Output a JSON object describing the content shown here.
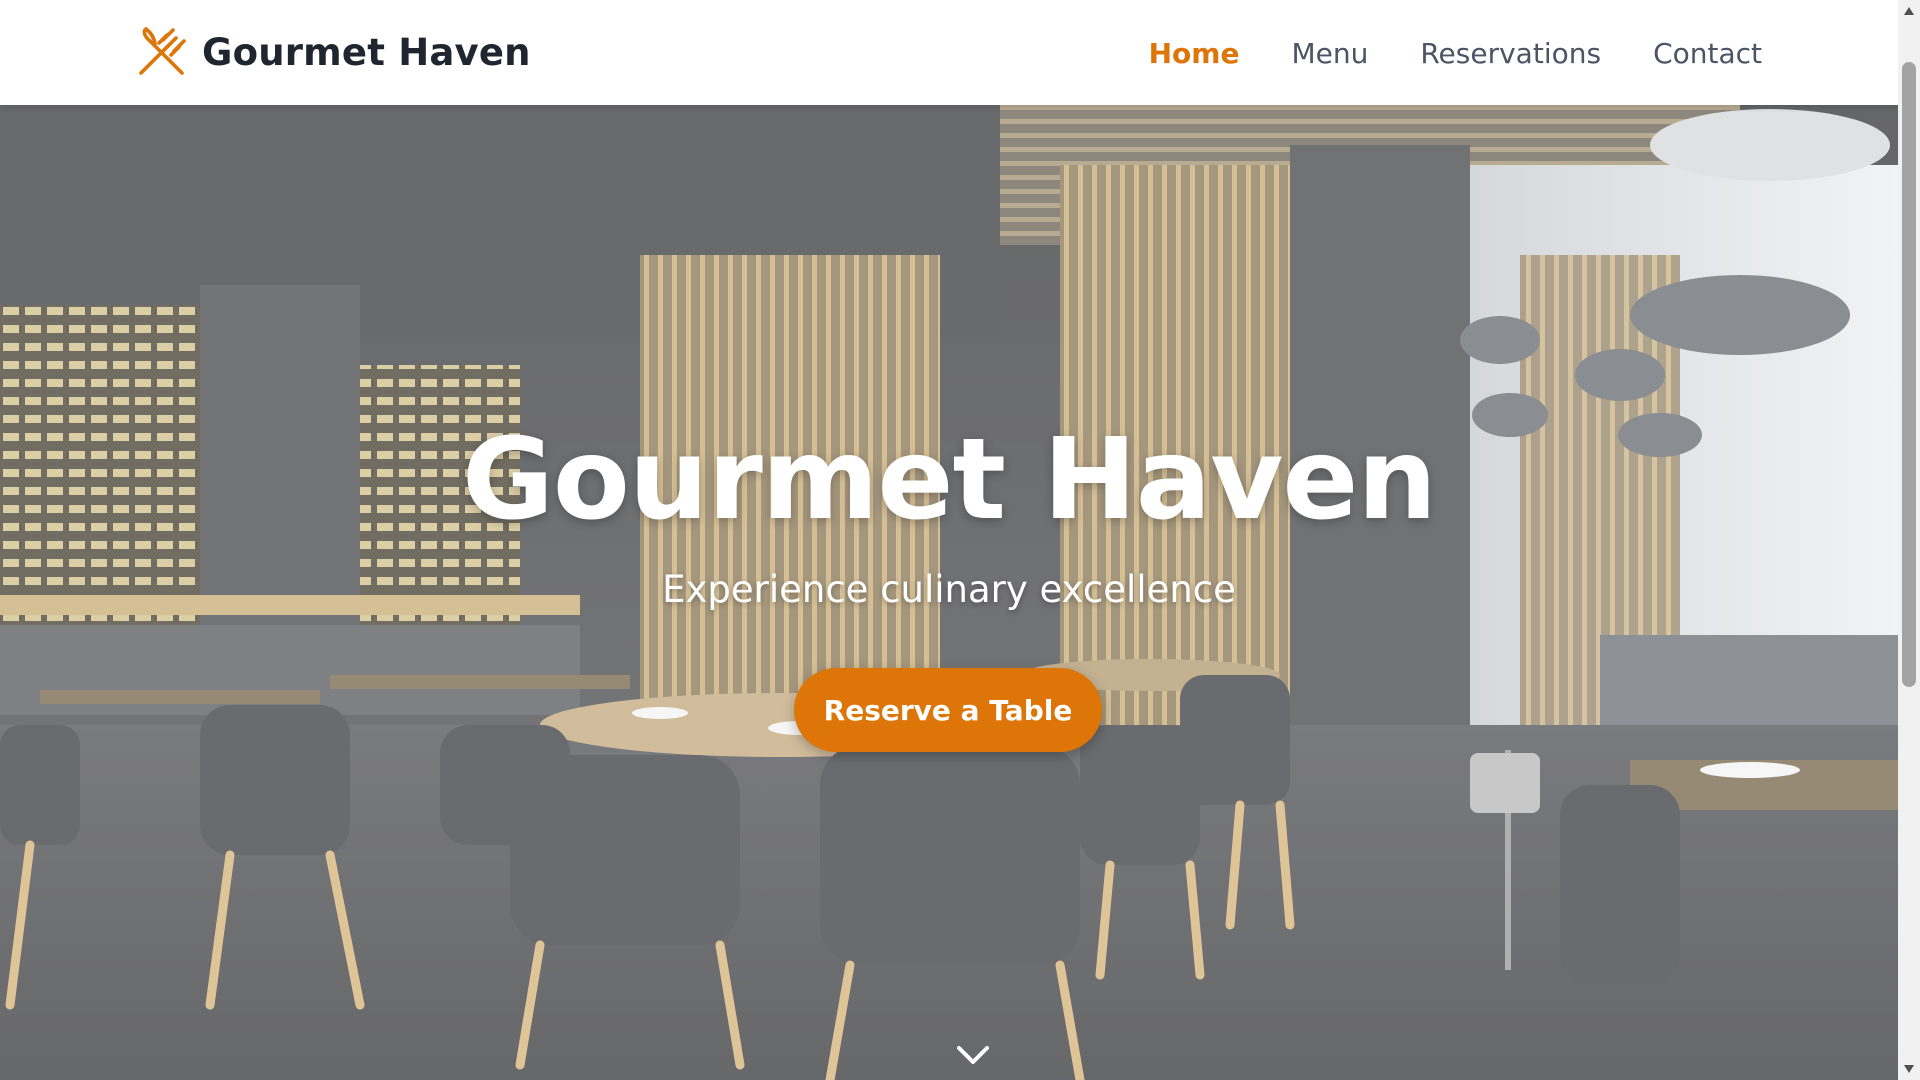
{
  "brand": {
    "name": "Gourmet Haven",
    "logo_icon": "utensils-cross-icon",
    "accent_color": "#dd7508"
  },
  "nav": {
    "items": [
      {
        "label": "Home",
        "active": true
      },
      {
        "label": "Menu",
        "active": false
      },
      {
        "label": "Reservations",
        "active": false
      },
      {
        "label": "Contact",
        "active": false
      }
    ]
  },
  "hero": {
    "background": "restaurant-interior-photo",
    "title": "Gourmet Haven",
    "subtitle": "Experience culinary excellence",
    "cta_label": "Reserve a Table",
    "scroll_icon": "chevron-down-icon"
  },
  "colors": {
    "text_dark": "#1f2630",
    "nav_text": "#4b5563",
    "accent": "#dd7508"
  }
}
